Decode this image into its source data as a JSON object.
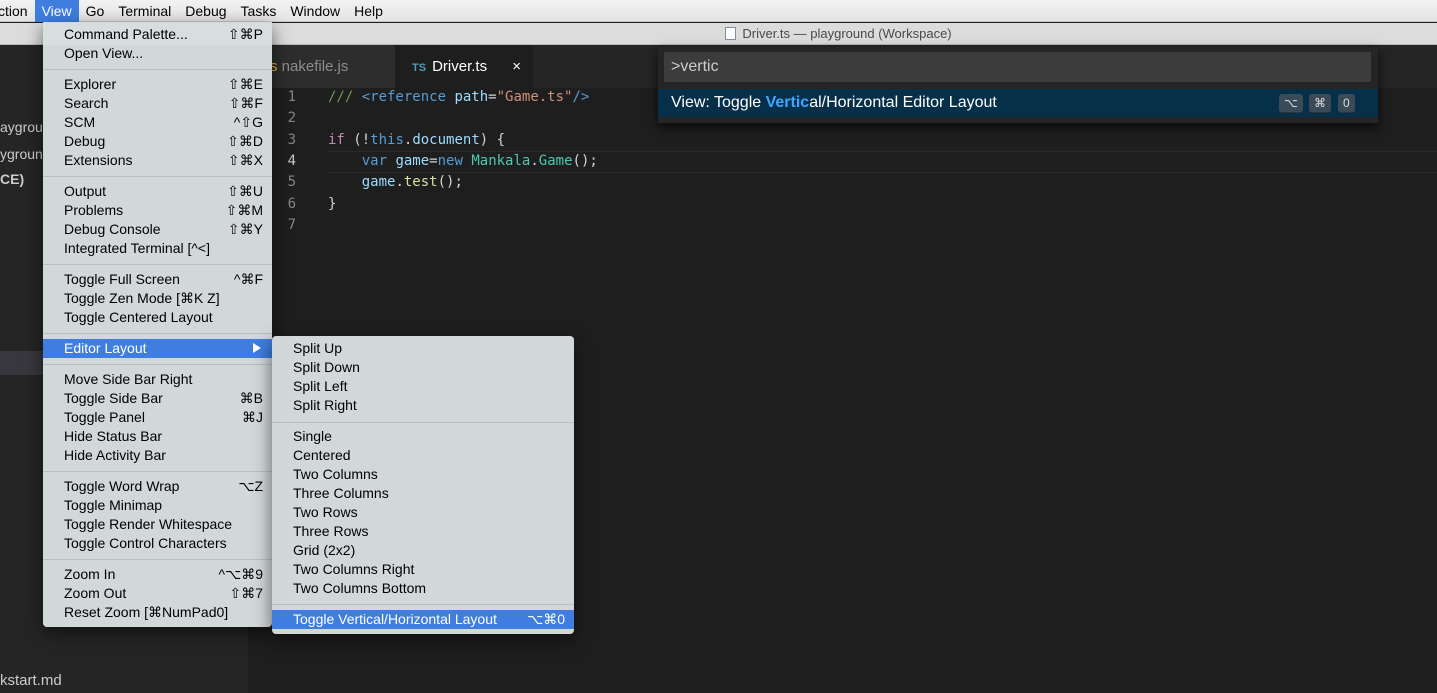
{
  "menubar": {
    "items": [
      "ction",
      "View",
      "Go",
      "Terminal",
      "Debug",
      "Tasks",
      "Window",
      "Help"
    ]
  },
  "titlebar": {
    "title": "Driver.ts — playground (Workspace)"
  },
  "sidebar": {
    "lines": [
      "aygrou",
      "ygroun",
      "CE)",
      "kstart.md"
    ]
  },
  "tabs": [
    {
      "prefix": "s",
      "label": "nakefile.js"
    },
    {
      "badge": "TS",
      "label": "Driver.ts",
      "close": "×"
    }
  ],
  "editor": {
    "line_numbers": [
      "1",
      "2",
      "3",
      "4",
      "5",
      "6",
      "7"
    ],
    "code": {
      "l1_comment": "/// ",
      "l1_tag_open": "<reference",
      "l1_attr": "path",
      "l1_eq": "=",
      "l1_str": "\"Game.ts\"",
      "l1_tag_close": "/>",
      "l3_if": "if",
      "l3_paren": " (!",
      "l3_this": "this",
      "l3_dot": ".",
      "l3_doc": "document",
      "l3_end": ") {",
      "l4_var": "var",
      "l4_game": "game",
      "l4_eq": "=",
      "l4_new": "new",
      "l4_mankala": "Mankala",
      "l4_dot": ".",
      "l4_gameclass": "Game",
      "l4_end": "();",
      "l5_game": "game",
      "l5_dot": ".",
      "l5_test": "test",
      "l5_end": "();",
      "l6": "}"
    }
  },
  "palette": {
    "input_value": ">vertic",
    "item_prefix": "View: Toggle ",
    "item_highlight": "Vertic",
    "item_suffix": "al/Horizontal Editor Layout",
    "keys": [
      "⌥",
      "⌘",
      "0"
    ]
  },
  "view_menu": {
    "command_palette": {
      "label": "Command Palette...",
      "shortcut": "⇧⌘P"
    },
    "open_view": {
      "label": "Open View..."
    },
    "explorer": {
      "label": "Explorer",
      "shortcut": "⇧⌘E"
    },
    "search": {
      "label": "Search",
      "shortcut": "⇧⌘F"
    },
    "scm": {
      "label": "SCM",
      "shortcut": "^⇧G"
    },
    "debug": {
      "label": "Debug",
      "shortcut": "⇧⌘D"
    },
    "extensions": {
      "label": "Extensions",
      "shortcut": "⇧⌘X"
    },
    "output": {
      "label": "Output",
      "shortcut": "⇧⌘U"
    },
    "problems": {
      "label": "Problems",
      "shortcut": "⇧⌘M"
    },
    "debug_console": {
      "label": "Debug Console",
      "shortcut": "⇧⌘Y"
    },
    "integrated_terminal": {
      "label": "Integrated Terminal [^<]"
    },
    "toggle_full_screen": {
      "label": "Toggle Full Screen",
      "shortcut": "^⌘F"
    },
    "toggle_zen_mode": {
      "label": "Toggle Zen Mode [⌘K Z]"
    },
    "toggle_centered_layout": {
      "label": "Toggle Centered Layout"
    },
    "editor_layout": {
      "label": "Editor Layout"
    },
    "move_side_bar_right": {
      "label": "Move Side Bar Right"
    },
    "toggle_side_bar": {
      "label": "Toggle Side Bar",
      "shortcut": "⌘B"
    },
    "toggle_panel": {
      "label": "Toggle Panel",
      "shortcut": "⌘J"
    },
    "hide_status_bar": {
      "label": "Hide Status Bar"
    },
    "hide_activity_bar": {
      "label": "Hide Activity Bar"
    },
    "toggle_word_wrap": {
      "label": "Toggle Word Wrap",
      "shortcut": "⌥Z"
    },
    "toggle_minimap": {
      "label": "Toggle Minimap"
    },
    "toggle_render_whitespace": {
      "label": "Toggle Render Whitespace"
    },
    "toggle_control_characters": {
      "label": "Toggle Control Characters"
    },
    "zoom_in": {
      "label": "Zoom In",
      "shortcut": "^⌥⌘9"
    },
    "zoom_out": {
      "label": "Zoom Out",
      "shortcut": "⇧⌘7"
    },
    "reset_zoom": {
      "label": "Reset Zoom [⌘NumPad0]"
    }
  },
  "layout_menu": {
    "split_up": "Split Up",
    "split_down": "Split Down",
    "split_left": "Split Left",
    "split_right": "Split Right",
    "single": "Single",
    "centered": "Centered",
    "two_columns": "Two Columns",
    "three_columns": "Three Columns",
    "two_rows": "Two Rows",
    "three_rows": "Three Rows",
    "grid": "Grid (2x2)",
    "two_columns_right": "Two Columns Right",
    "two_columns_bottom": "Two Columns Bottom",
    "toggle_layout": {
      "label": "Toggle Vertical/Horizontal Layout",
      "shortcut": "⌥⌘0"
    }
  },
  "colors": {
    "menu_highlight": "#3f7ee0",
    "palette_match": "#3ea6ff",
    "editor_bg": "#1e1e1e",
    "sidebar_bg": "#252526"
  }
}
